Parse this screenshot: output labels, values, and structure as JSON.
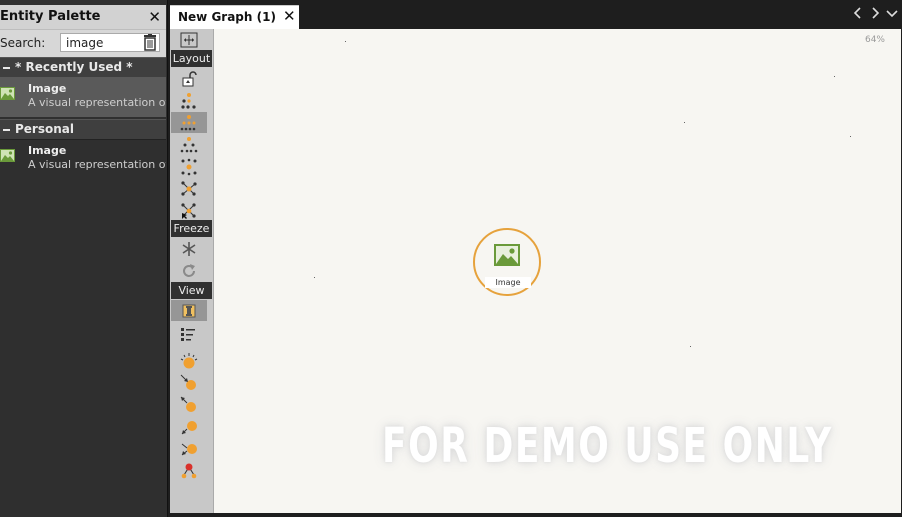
{
  "palette": {
    "title": "Entity Palette",
    "close_glyph": "✕",
    "search": {
      "label": "Search:",
      "value": "image"
    },
    "sections": [
      {
        "label": "* Recently Used *",
        "items": [
          {
            "name": "Image",
            "description": "A visual representation of",
            "icon": "image-icon",
            "selected": true
          }
        ]
      },
      {
        "label": "Personal",
        "items": [
          {
            "name": "Image",
            "description": "A visual representation of",
            "icon": "image-icon",
            "selected": false
          }
        ]
      }
    ]
  },
  "tabs": [
    {
      "title": "New Graph (1)",
      "close_glyph": "✕"
    }
  ],
  "toolbar": {
    "layout_label": "Layout",
    "freeze_label": "Freeze",
    "view_label": "View"
  },
  "canvas": {
    "zoom_label": "64%",
    "node": {
      "label": "Image",
      "icon": "image-icon",
      "border_color": "#e6a23c"
    },
    "watermark": "FOR DEMO USE ONLY"
  },
  "colors": {
    "accent_orange": "#f0a030",
    "image_green": "#6a9a3a",
    "canvas_bg": "#f7f6f2"
  }
}
